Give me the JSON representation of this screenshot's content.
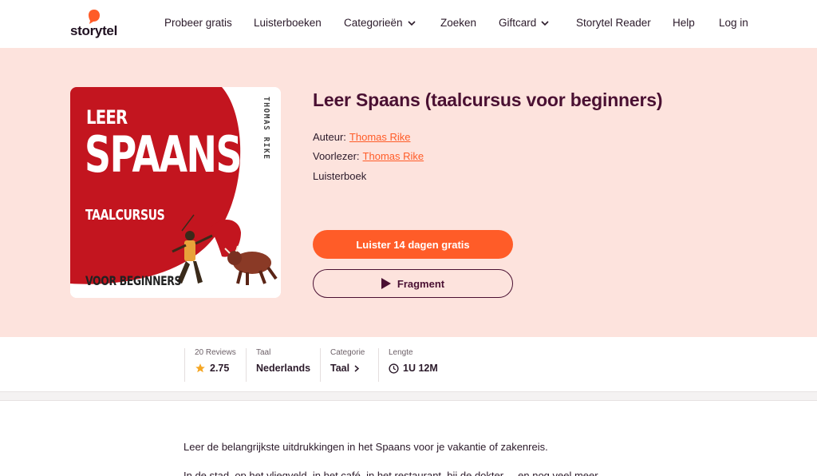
{
  "header": {
    "logo_text": "storytel",
    "nav": [
      {
        "label": "Probeer gratis"
      },
      {
        "label": "Luisterboeken"
      },
      {
        "label": "Categorieën"
      },
      {
        "label": "Zoeken"
      },
      {
        "label": "Giftcard"
      },
      {
        "label": "Storytel Reader"
      },
      {
        "label": "Help"
      },
      {
        "label": "Log in"
      }
    ]
  },
  "book": {
    "cover": {
      "line1": "LEER",
      "line2": "SPAANS",
      "line3": "TAALCURSUS",
      "line4": "VOOR BEGINNERS",
      "author_vertical": "THOMAS RIKE"
    },
    "title": "Leer Spaans (taalcursus voor beginners)",
    "author_label": "Auteur:",
    "author": "Thomas Rike",
    "narrator_label": "Voorlezer:",
    "narrator": "Thomas Rike",
    "format": "Luisterboek",
    "cta_primary": "Luister 14 dagen gratis",
    "cta_secondary": "Fragment"
  },
  "info": {
    "reviews_label": "20 Reviews",
    "rating": "2.75",
    "language_label": "Taal",
    "language": "Nederlands",
    "category_label": "Categorie",
    "category": "Taal",
    "length_label": "Lengte",
    "length": "1U 12M"
  },
  "description": {
    "line1": "Leer de belangrijkste uitdrukkingen in het Spaans voor je vakantie of zakenreis.",
    "line2": "In de stad, op het vliegveld, in het café, in het restaurant, bij de dokter ... en nog veel meer."
  },
  "colors": {
    "accent": "#ff5c28",
    "hero_bg": "#fde3dd",
    "title": "#4a1032",
    "cover_red": "#c3151f"
  }
}
